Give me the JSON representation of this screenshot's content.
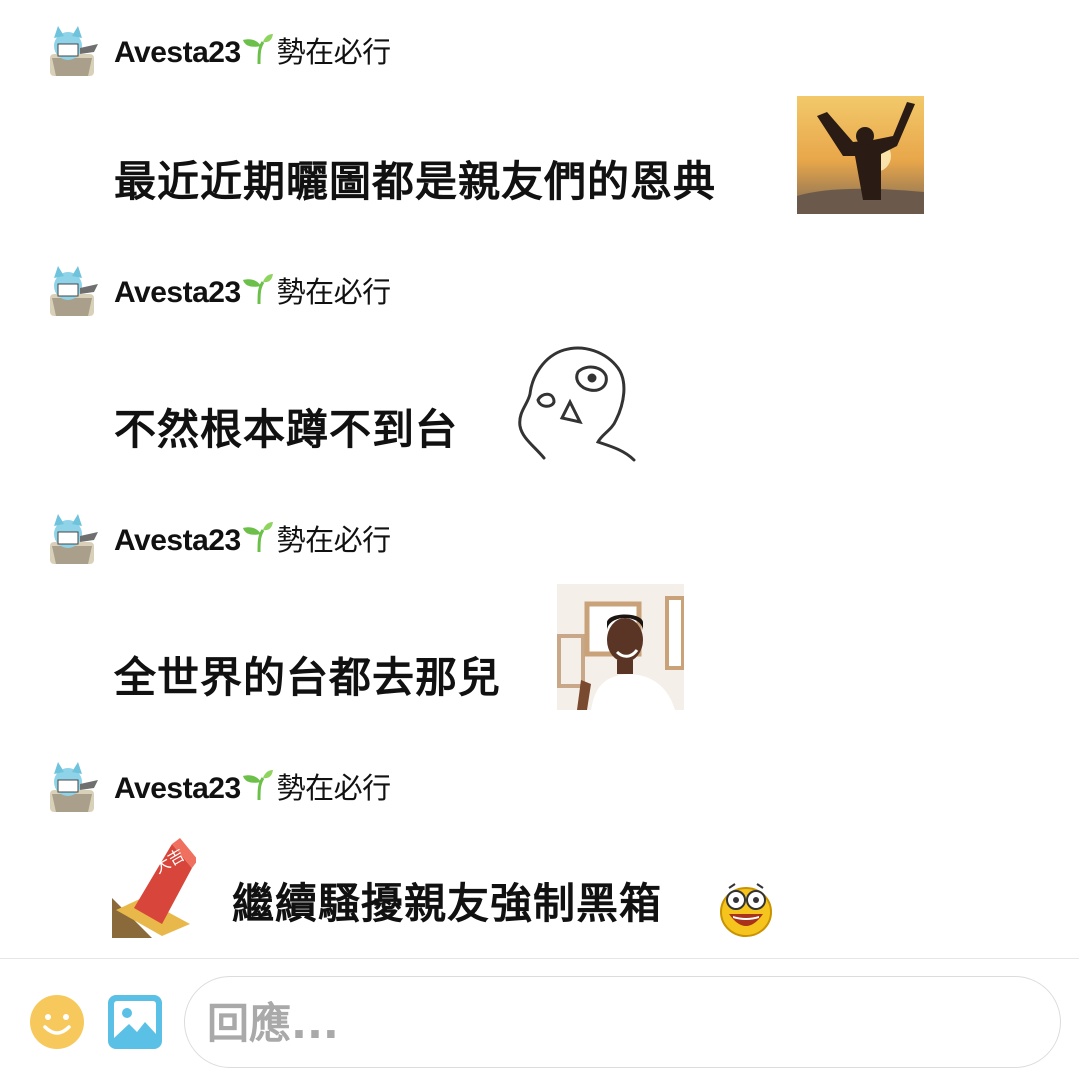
{
  "messages": [
    {
      "author": "Avesta23",
      "author_tag": "勢在必行",
      "text": "最近近期曬圖都是親友們的恩典",
      "sticker": "raised-arms-sunset-sticker"
    },
    {
      "author": "Avesta23",
      "author_tag": "勢在必行",
      "text": "不然根本蹲不到台",
      "sticker": "sketch-face-sticker"
    },
    {
      "author": "Avesta23",
      "author_tag": "勢在必行",
      "text": "全世界的台都去那兒",
      "sticker": "looking-around-man-sticker"
    },
    {
      "author": "Avesta23",
      "author_tag": "勢在必行",
      "text": "繼續騷擾親友強制黑箱",
      "lead_sticker": "omikuji-stamp-sticker",
      "lead_sticker_text": "大吉",
      "emoji": "excited-face-emoji"
    }
  ],
  "composer": {
    "placeholder": "回應...",
    "emoji_icon": "smiley-icon",
    "image_icon": "image-icon"
  },
  "colors": {
    "emoji_button": "#f7c95c",
    "image_button": "#5bc0e6",
    "sprout": "#6cc04a"
  }
}
